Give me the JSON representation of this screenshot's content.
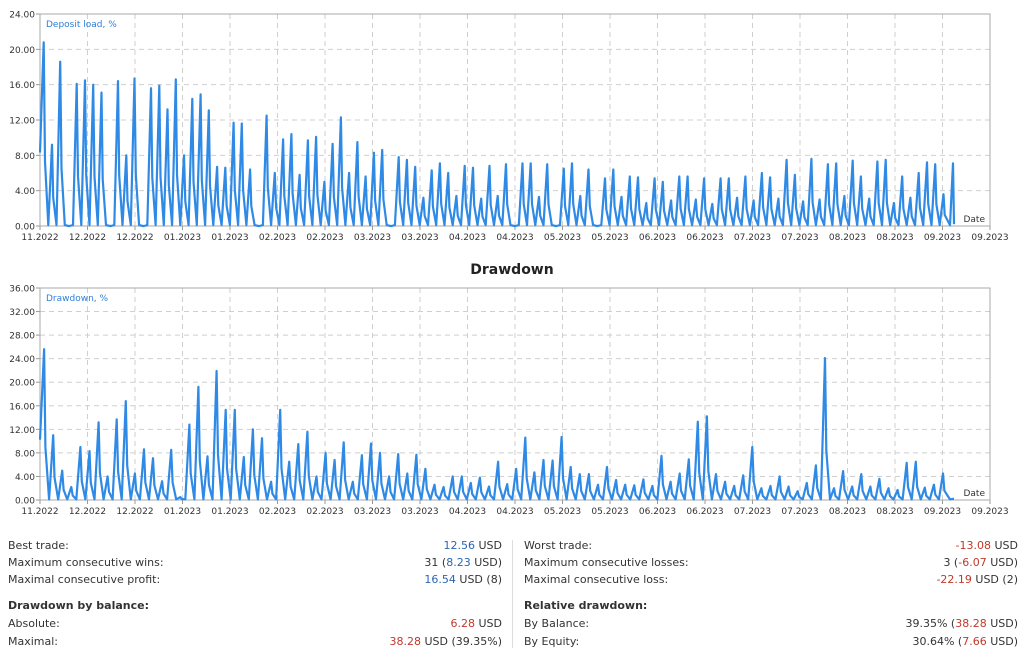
{
  "chart_data": [
    {
      "type": "line",
      "title": "",
      "series": [
        {
          "name": "Deposit load, %"
        }
      ],
      "ylim": [
        0,
        24
      ],
      "yticks": [
        "0.00",
        "4.00",
        "8.00",
        "12.00",
        "16.00",
        "20.00",
        "24.00"
      ],
      "xticks": [
        "11.2022",
        "12.2022",
        "12.2022",
        "01.2023",
        "01.2023",
        "02.2023",
        "02.2023",
        "03.2023",
        "03.2023",
        "04.2023",
        "04.2023",
        "05.2023",
        "05.2023",
        "06.2023",
        "06.2023",
        "07.2023",
        "07.2023",
        "08.2023",
        "08.2023",
        "09.2023",
        "09.2023"
      ],
      "xlabel": "Date",
      "grid": true,
      "color": "#2f8ae6",
      "peaks": [
        20.8,
        9.2,
        18.6,
        0,
        16.1,
        16.5,
        16.0,
        15.1,
        0,
        16.4,
        8.0,
        16.7,
        0,
        15.6,
        15.9,
        13.2,
        16.6,
        8.0,
        14.4,
        14.9,
        13.1,
        6.7,
        6.6,
        11.7,
        11.6,
        6.4,
        0,
        12.5,
        6.0,
        9.8,
        10.4,
        5.8,
        9.7,
        10.1,
        5.0,
        9.3,
        12.3,
        6.0,
        9.5,
        5.6,
        8.3,
        8.6,
        0,
        7.8,
        7.5,
        6.7,
        3.2,
        6.3,
        7.1,
        6.0,
        3.4,
        6.8,
        6.6,
        3.1,
        6.8,
        3.4,
        7.0,
        0,
        7.1,
        7.1,
        3.3,
        7.0,
        0,
        6.5,
        7.1,
        3.4,
        6.4,
        0,
        5.4,
        6.4,
        3.3,
        5.6,
        5.5,
        2.6,
        5.4,
        5.0,
        2.9,
        5.6,
        5.6,
        3.0,
        5.4,
        2.5,
        5.4,
        5.4,
        3.2,
        5.6,
        2.9,
        6.0,
        5.5,
        3.1,
        7.5,
        5.8,
        2.8,
        7.6,
        3.0,
        7.0,
        7.1,
        3.4,
        7.4,
        5.6,
        3.1,
        7.3,
        7.5,
        2.6,
        5.6,
        3.2,
        6.0,
        7.2,
        7.0,
        3.6
      ],
      "last_value": 7.1
    },
    {
      "type": "line",
      "title": "Drawdown",
      "series": [
        {
          "name": "Drawdown, %"
        }
      ],
      "ylim": [
        0,
        36
      ],
      "yticks": [
        "0.00",
        "4.00",
        "8.00",
        "12.00",
        "16.00",
        "20.00",
        "24.00",
        "28.00",
        "32.00",
        "36.00"
      ],
      "xticks": [
        "11.2022",
        "12.2022",
        "12.2022",
        "01.2023",
        "01.2023",
        "02.2023",
        "02.2023",
        "03.2023",
        "03.2023",
        "04.2023",
        "04.2023",
        "05.2023",
        "05.2023",
        "06.2023",
        "06.2023",
        "07.2023",
        "07.2023",
        "08.2023",
        "08.2023",
        "09.2023",
        "09.2023"
      ],
      "xlabel": "Date",
      "grid": true,
      "color": "#2f8ae6",
      "peaks": [
        25.6,
        11.0,
        5.0,
        2.2,
        9.0,
        8.3,
        13.2,
        4.0,
        13.7,
        16.8,
        4.5,
        8.6,
        7.1,
        3.2,
        8.5,
        0.5,
        12.8,
        19.2,
        7.4,
        21.9,
        15.3,
        15.3,
        7.3,
        12.0,
        10.5,
        3.1,
        15.3,
        6.5,
        9.5,
        11.6,
        4.0,
        8.0,
        6.8,
        9.8,
        3.1,
        7.6,
        9.6,
        8.0,
        4.0,
        7.8,
        4.5,
        7.7,
        5.3,
        2.6,
        2.2,
        4.0,
        4.0,
        2.9,
        3.8,
        2.3,
        6.5,
        2.7,
        5.3,
        10.6,
        4.7,
        6.8,
        6.7,
        10.7,
        5.6,
        4.4,
        4.4,
        2.6,
        5.6,
        3.4,
        2.6,
        2.5,
        3.5,
        2.4,
        7.5,
        3.1,
        4.5,
        6.9,
        13.3,
        14.2,
        4.4,
        3.1,
        2.4,
        4.2,
        9.0,
        2.0,
        2.4,
        4.0,
        2.3,
        1.5,
        2.9,
        5.9,
        24.1,
        2.0,
        4.9,
        2.3,
        4.4,
        2.3,
        3.6,
        2.0,
        1.7,
        6.3,
        6.5,
        2.1,
        2.6,
        4.5
      ],
      "last_value": 0.2
    }
  ],
  "stats": {
    "left": [
      {
        "label": "Best trade:",
        "parts": [
          {
            "text": "12.56",
            "color": "blue"
          },
          {
            "text": " USD",
            "color": ""
          }
        ]
      },
      {
        "label": "Maximum consecutive wins:",
        "parts": [
          {
            "text": "31 (",
            "color": ""
          },
          {
            "text": "8.23",
            "color": "blue"
          },
          {
            "text": " USD)",
            "color": ""
          }
        ]
      },
      {
        "label": "Maximal consecutive profit:",
        "parts": [
          {
            "text": "16.54",
            "color": "blue"
          },
          {
            "text": " USD (8)",
            "color": ""
          }
        ]
      },
      {
        "label": "Drawdown by balance:",
        "header": true,
        "parts": []
      },
      {
        "label": "Absolute:",
        "parts": [
          {
            "text": "6.28",
            "color": "red"
          },
          {
            "text": " USD",
            "color": ""
          }
        ]
      },
      {
        "label": "Maximal:",
        "parts": [
          {
            "text": "38.28",
            "color": "red"
          },
          {
            "text": " USD (39.35%)",
            "color": ""
          }
        ]
      }
    ],
    "right": [
      {
        "label": "Worst trade:",
        "parts": [
          {
            "text": "-13.08",
            "color": "red"
          },
          {
            "text": " USD",
            "color": ""
          }
        ]
      },
      {
        "label": "Maximum consecutive losses:",
        "parts": [
          {
            "text": "3 (",
            "color": ""
          },
          {
            "text": "-6.07",
            "color": "red"
          },
          {
            "text": " USD)",
            "color": ""
          }
        ]
      },
      {
        "label": "Maximal consecutive loss:",
        "parts": [
          {
            "text": "-22.19",
            "color": "red"
          },
          {
            "text": " USD (2)",
            "color": ""
          }
        ]
      },
      {
        "label": "Relative drawdown:",
        "header": true,
        "parts": []
      },
      {
        "label": "By Balance:",
        "parts": [
          {
            "text": "39.35% (",
            "color": ""
          },
          {
            "text": "38.28",
            "color": "red"
          },
          {
            "text": " USD)",
            "color": ""
          }
        ]
      },
      {
        "label": "By Equity:",
        "parts": [
          {
            "text": "30.64% (",
            "color": ""
          },
          {
            "text": "7.66",
            "color": "red"
          },
          {
            "text": " USD)",
            "color": ""
          }
        ]
      }
    ]
  }
}
